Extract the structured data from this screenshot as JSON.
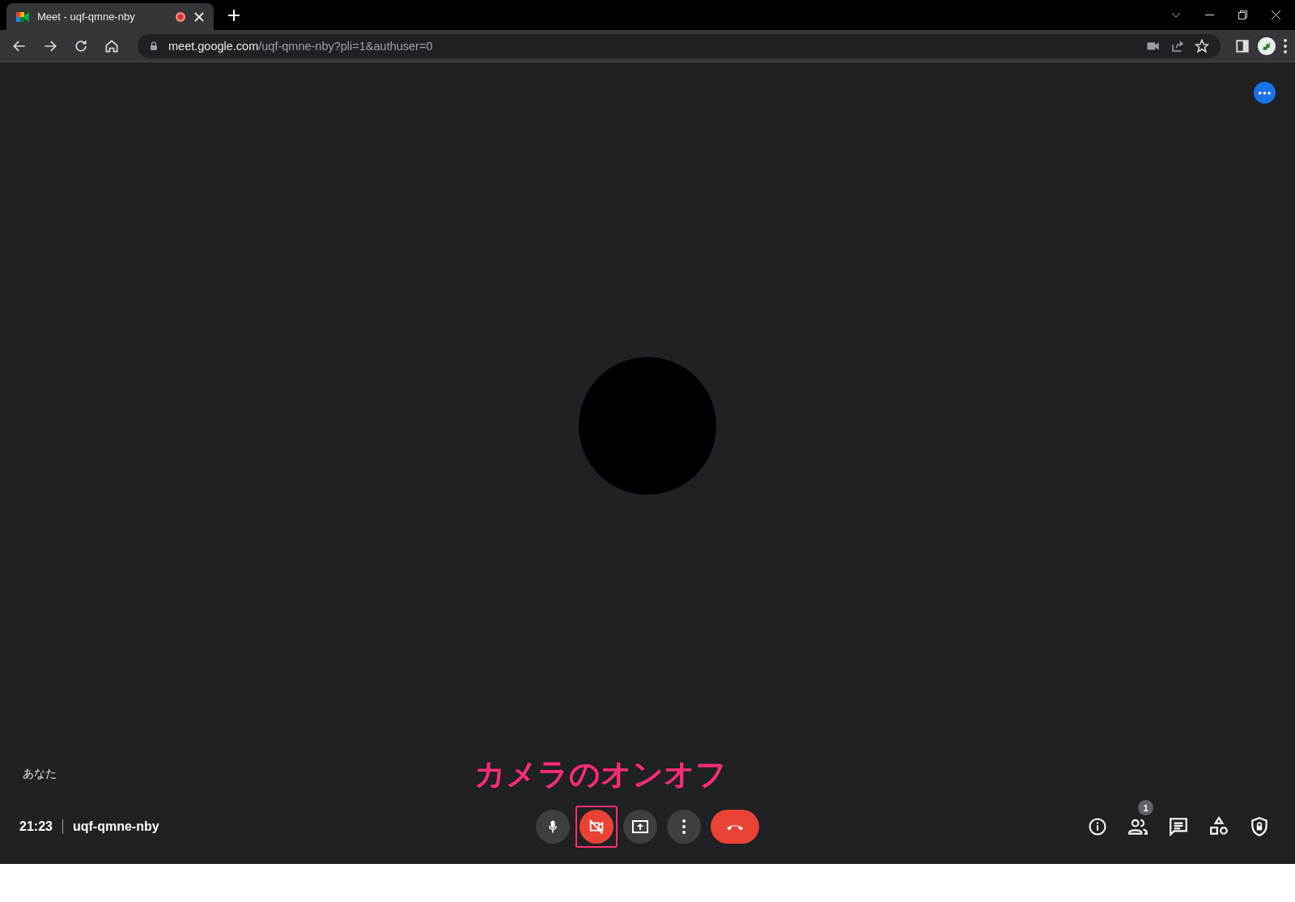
{
  "browser": {
    "tab": {
      "title": "Meet - uqf-qmne-nby",
      "recording": true
    },
    "url": "**meet.google.com**/uqf-qmne-nby?pli=1&authuser=0"
  },
  "tile": {
    "name": "あなた"
  },
  "annotation": {
    "text": "カメラのオンオフ"
  },
  "footer": {
    "time": "21:23",
    "meeting_code": "uqf-qmne-nby"
  },
  "controls": [
    {
      "kind": "mic",
      "on": true,
      "highlighted": false
    },
    {
      "kind": "camera",
      "on": false,
      "highlighted": true
    },
    {
      "kind": "present",
      "on": true,
      "highlighted": false
    },
    {
      "kind": "more",
      "on": true,
      "highlighted": false
    },
    {
      "kind": "hangup",
      "highlighted": false
    }
  ],
  "side_actions": [
    {
      "kind": "info"
    },
    {
      "kind": "people",
      "badge": "1"
    },
    {
      "kind": "chat"
    },
    {
      "kind": "activities"
    },
    {
      "kind": "host"
    }
  ]
}
